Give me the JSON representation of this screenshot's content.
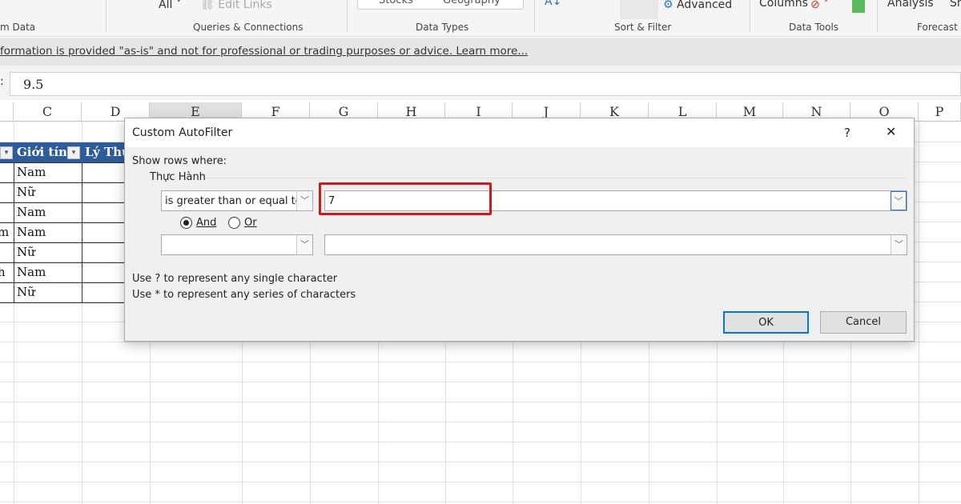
{
  "ribbon": {
    "all_label": "All",
    "edit_links": "Edit Links",
    "stocks": "Stocks",
    "geography": "Geography",
    "advanced": "Advanced",
    "columns": "Columns",
    "analysis": "Analysis",
    "sh": "Sh",
    "groups": [
      "m Data",
      "Queries & Connections",
      "Data Types",
      "Sort & Filter",
      "Data Tools",
      "Forecast"
    ]
  },
  "info_bar": {
    "text": "formation is provided \"as-is\" and not for professional or trading purposes or advice. Learn more..."
  },
  "formula_bar": {
    "value": "9.5"
  },
  "columns": [
    "C",
    "D",
    "E",
    "F",
    "G",
    "H",
    "I",
    "J",
    "K",
    "L",
    "M",
    "N",
    "O",
    "P"
  ],
  "table": {
    "headers": [
      "Giới tính",
      "Lý Thu"
    ],
    "left_partial": [
      "",
      "",
      "",
      "m",
      "",
      "h",
      ""
    ],
    "gender": [
      "Nam",
      "Nữ",
      "Nam",
      "Nam",
      "Nữ",
      "Nam",
      "Nữ"
    ]
  },
  "dialog": {
    "title": "Custom AutoFilter",
    "help": "?",
    "close": "✕",
    "show_rows": "Show rows where:",
    "field": "Thực Hành",
    "op1": "is greater than or equal to",
    "val1": "7",
    "and": "And",
    "or": "Or",
    "op2": "",
    "val2": "",
    "hint1": "Use ? to represent any single character",
    "hint2": "Use * to represent any series of characters",
    "ok": "OK",
    "cancel": "Cancel",
    "highlight_color": "#d0191f"
  }
}
